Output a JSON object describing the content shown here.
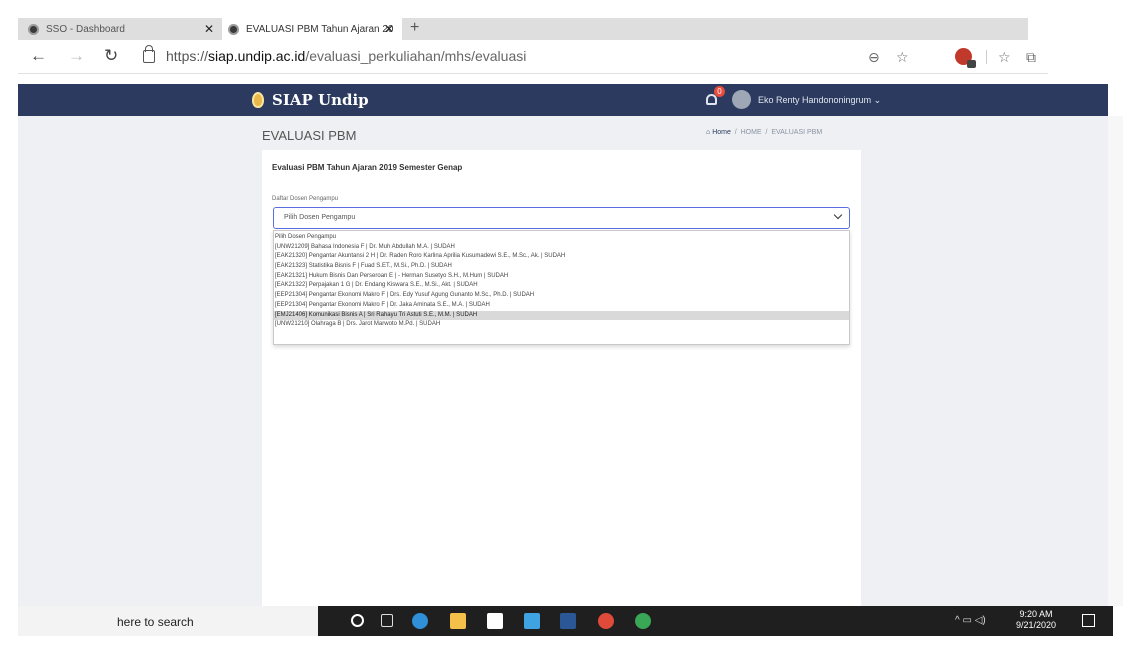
{
  "browser": {
    "tabs": [
      {
        "title": "SSO - Dashboard",
        "active": false
      },
      {
        "title": "EVALUASI PBM Tahun Ajaran 20",
        "active": false
      }
    ],
    "active_tab_index": 1,
    "url_prefix": "https://",
    "url_host": "siap.undip.ac.id",
    "url_path": "/evaluasi_perkuliahan/mhs/evaluasi",
    "icons": [
      "back-icon",
      "forward-icon",
      "reload-icon",
      "lock-icon",
      "zoom-icon",
      "star-icon",
      "extension-icon",
      "favorites-icon",
      "collections-icon"
    ]
  },
  "header": {
    "brand": "SIAP Undip",
    "notification_count": "0",
    "user_name": "Eko Renty Handononingrum"
  },
  "page": {
    "title": "EVALUASI PBM",
    "breadcrumb": {
      "home": "Home",
      "parent": "HOME",
      "current": "EVALUASI PBM"
    }
  },
  "card": {
    "title": "Evaluasi PBM Tahun Ajaran 2019 Semester Genap",
    "field_label": "Daftar Dosen Pengampu",
    "select_value": "Pilih Dosen Pengampu",
    "options": [
      "Pilih Dosen Pengampu",
      "[UNW21209] Bahasa Indonesia F | Dr. Muh Abdullah M.A. | SUDAH",
      "[EAK21320] Pengantar Akuntansi 2 H | Dr. Raden Roro Karlina Aprilia Kusumadewi S.E., M.Sc., Ak. | SUDAH",
      "[EAK21323] Statistika Bisnis F | Fuad S.ET., M.Si., Ph.D. | SUDAH",
      "[EAK21321] Hukum Bisnis Dan Perseroan E | - Herman Susetyo S.H., M.Hum | SUDAH",
      "[EAK21322] Perpajakan 1 G | Dr. Endang Kiswara S.E., M.Si., Akt. | SUDAH",
      "[EEP21304] Pengantar Ekonomi Makro F | Drs. Edy Yusuf Agung Gunanto M.Sc., Ph.D. | SUDAH",
      "[EEP21304] Pengantar Ekonomi Makro F | Dr. Jaka Aminata S.E., M.A. | SUDAH",
      "[EMJ21406] Komunikasi Bisnis A | Sri Rahayu Tri Astuti S.E., M.M. | SUDAH",
      "[UNW21210] Olahraga B | Drs. Jarot Marwoto M.Pd. | SUDAH"
    ],
    "highlighted_index": 8
  },
  "taskbar": {
    "search_text": "here to search",
    "time": "9:20 AM",
    "date": "9/21/2020",
    "apps": [
      "start-icon",
      "task-view-icon",
      "edge-icon",
      "file-explorer-icon",
      "store-icon",
      "mail-icon",
      "word-icon",
      "chrome-icon",
      "chrome-alt-icon"
    ]
  }
}
